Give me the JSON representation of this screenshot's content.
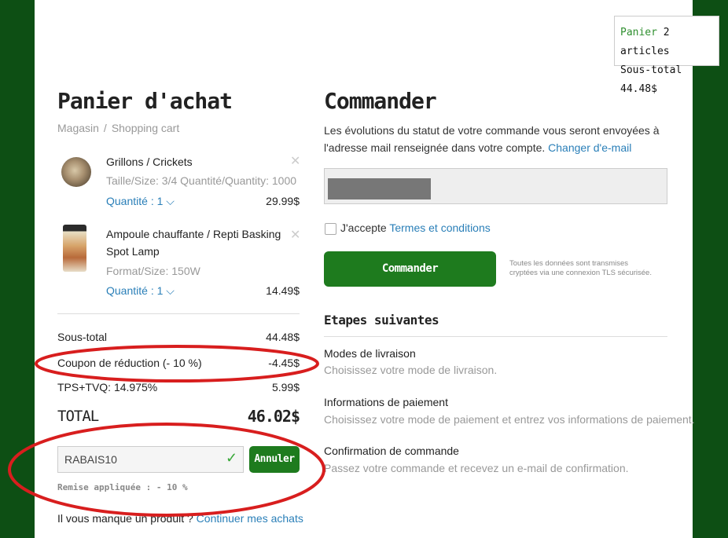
{
  "mini_cart": {
    "cart_label": "Panier",
    "count": "2 articles",
    "subtotal_label": "Sous-total",
    "subtotal_value": "44.48$"
  },
  "cart": {
    "title": "Panier d'achat",
    "breadcrumb": [
      "Magasin",
      "Shopping cart"
    ],
    "items": [
      {
        "name": "Grillons / Crickets",
        "size": "Taille/Size: 3/4  Quantité/Quantity: 1000",
        "quantity": "Quantité : 1 ⌵",
        "price": "29.99$"
      },
      {
        "name_line1": "Ampoule chauffante / Repti Basking",
        "name_line2": "Spot Lamp",
        "size": "Format/Size: 150W",
        "quantity": "Quantité : 1 ⌵",
        "price": "14.49$"
      }
    ],
    "summary": {
      "subtotal_label": "Sous-total",
      "subtotal_value": "44.48$",
      "coupon_label": "Coupon de réduction (- 10 %)",
      "coupon_value": "-4.45$",
      "tax_label": "TPS+TVQ: 14.975%",
      "tax_value": "5.99$",
      "total_label": "TOTAL",
      "total_value": "46.02$"
    },
    "coupon": {
      "code": "RABAIS10",
      "cancel_label": "Annuler",
      "note": "Remise appliquée : - 10 %"
    },
    "missing_text": "Il vous manque un produit ?",
    "continue_link": "Continuer mes achats"
  },
  "order": {
    "title": "Commander",
    "desc": "Les évolutions du statut de votre commande vous seront envoyées à l'adresse mail renseignée dans votre compte.",
    "change_email_link": "Changer d'e-mail",
    "terms_prefix": "J'accepte",
    "terms_link": "Termes et conditions",
    "button_label": "Commander",
    "secure_line1": "Toutes les données sont transmises",
    "secure_line2": "cryptées via une connexion TLS sécurisée.",
    "steps_title": "Etapes suivantes",
    "steps": [
      {
        "title": "Modes de livraison",
        "desc": "Choisissez votre mode de livraison."
      },
      {
        "title": "Informations de paiement",
        "desc": "Choisissez votre mode de paiement et entrez vos informations de paiement."
      },
      {
        "title": "Confirmation de commande",
        "desc": "Passez votre commande et recevez un e-mail de confirmation."
      }
    ]
  },
  "colors": {
    "page_bg": "#0d4f14",
    "accent_green": "#1e7b1e",
    "link_blue": "#2a7fb8",
    "annotation_red": "#d81e1e"
  }
}
